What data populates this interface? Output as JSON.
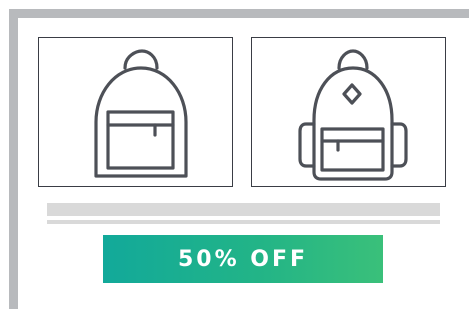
{
  "products": [
    {
      "icon": "backpack-simple-icon"
    },
    {
      "icon": "backpack-with-diamond-icon"
    }
  ],
  "promo": {
    "label": "50% OFF",
    "gradient_start": "#12a99a",
    "gradient_end": "#3ac07a"
  },
  "colors": {
    "frame": "#b8babd",
    "icon_stroke": "#4d5057",
    "placeholder_bar": "#d9d9d9"
  }
}
